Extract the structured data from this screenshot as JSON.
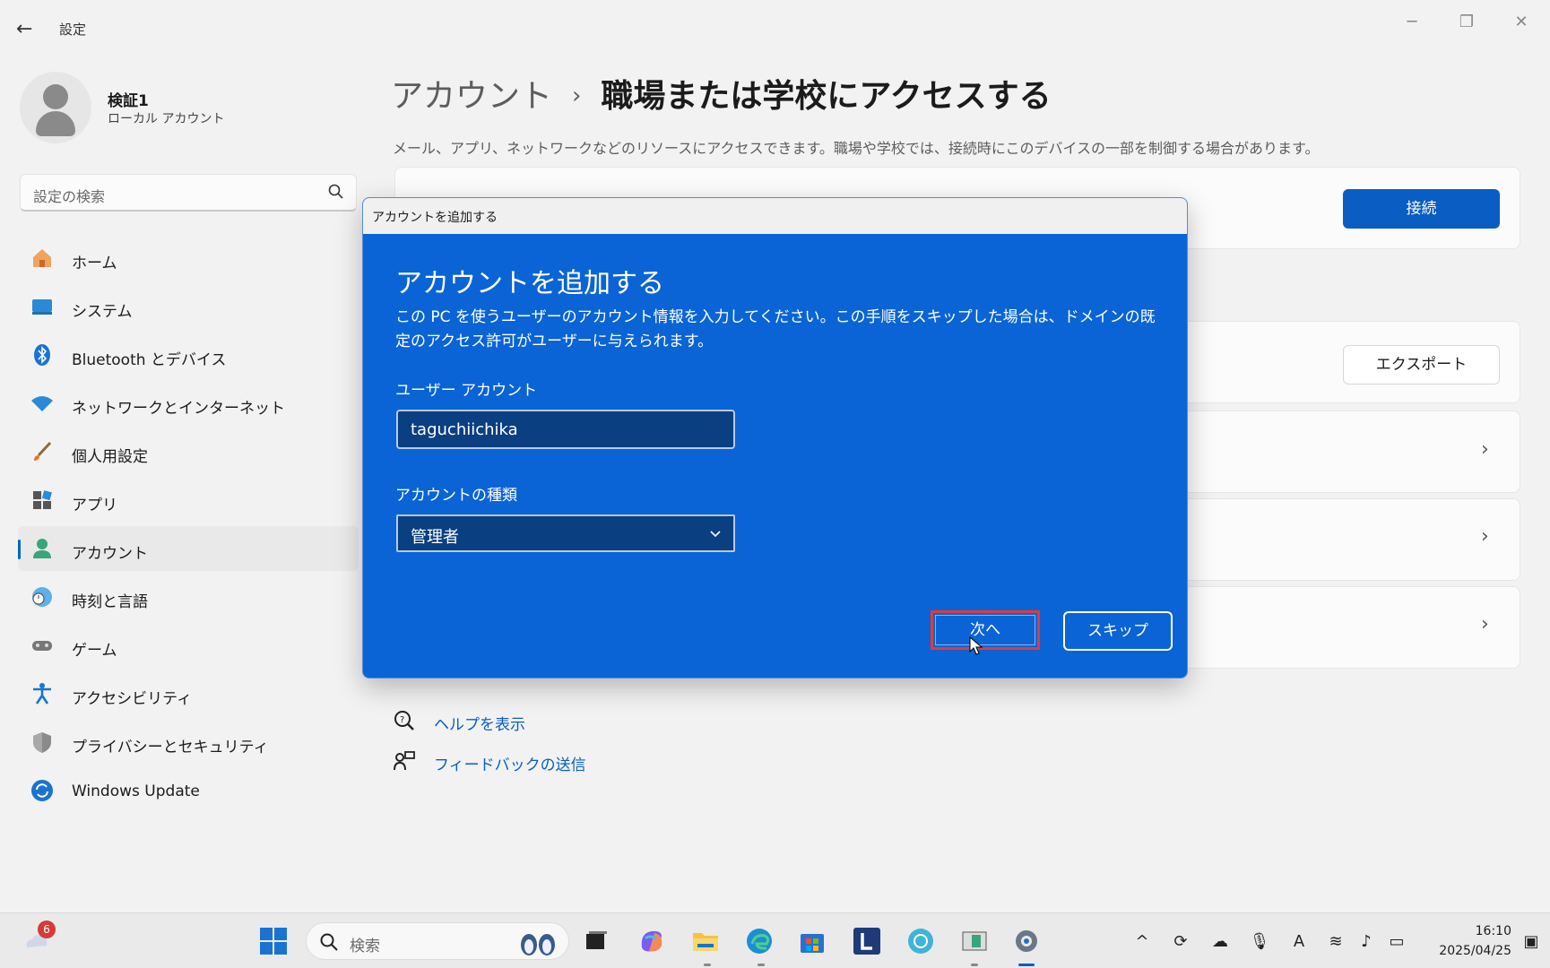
{
  "window": {
    "title": "設定",
    "controls": {
      "minimize": "─",
      "maximize": "❐",
      "close": "✕"
    },
    "back": "←"
  },
  "user": {
    "name": "検証1",
    "account_type": "ローカル アカウント"
  },
  "search": {
    "placeholder": "設定の検索"
  },
  "sidebar": {
    "items": [
      {
        "label": "ホーム",
        "icon": "home-icon"
      },
      {
        "label": "システム",
        "icon": "system-icon"
      },
      {
        "label": "Bluetooth とデバイス",
        "icon": "bluetooth-icon"
      },
      {
        "label": "ネットワークとインターネット",
        "icon": "network-icon"
      },
      {
        "label": "個人用設定",
        "icon": "brush-icon"
      },
      {
        "label": "アプリ",
        "icon": "apps-icon"
      },
      {
        "label": "アカウント",
        "icon": "account-icon",
        "active": true
      },
      {
        "label": "時刻と言語",
        "icon": "time-language-icon"
      },
      {
        "label": "ゲーム",
        "icon": "gamepad-icon"
      },
      {
        "label": "アクセシビリティ",
        "icon": "accessibility-icon"
      },
      {
        "label": "プライバシーとセキュリティ",
        "icon": "shield-icon"
      },
      {
        "label": "Windows Update",
        "icon": "windows-update-icon"
      }
    ]
  },
  "main": {
    "breadcrumb_parent": "アカウント",
    "breadcrumb_sep": "›",
    "breadcrumb_current": "職場または学校にアクセスする",
    "description": "メール、アプリ、ネットワークなどのリソースにアクセスできます。職場や学校では、接続時にこのデバイスの一部を制御する場合があります。",
    "connect_button": "接続",
    "export_button": "エクスポート",
    "chevron": "›",
    "help_link": "ヘルプを表示",
    "feedback_link": "フィードバックの送信"
  },
  "dialog": {
    "window_title": "アカウントを追加する",
    "heading": "アカウントを追加する",
    "text": "この PC を使うユーザーのアカウント情報を入力してください。この手順をスキップした場合は、ドメインの既定のアクセス許可がユーザーに与えられます。",
    "user_label": "ユーザー アカウント",
    "user_value": "taguchiichika",
    "type_label": "アカウントの種類",
    "type_value": "管理者",
    "next_button": "次へ",
    "skip_button": "スキップ"
  },
  "taskbar": {
    "search_placeholder": "検索",
    "badge_count": "6",
    "time": "16:10",
    "date": "2025/04/25"
  },
  "colors": {
    "accent": "#0a5dc2",
    "dialog_bg": "#0a64d6",
    "highlight": "#e53935"
  }
}
